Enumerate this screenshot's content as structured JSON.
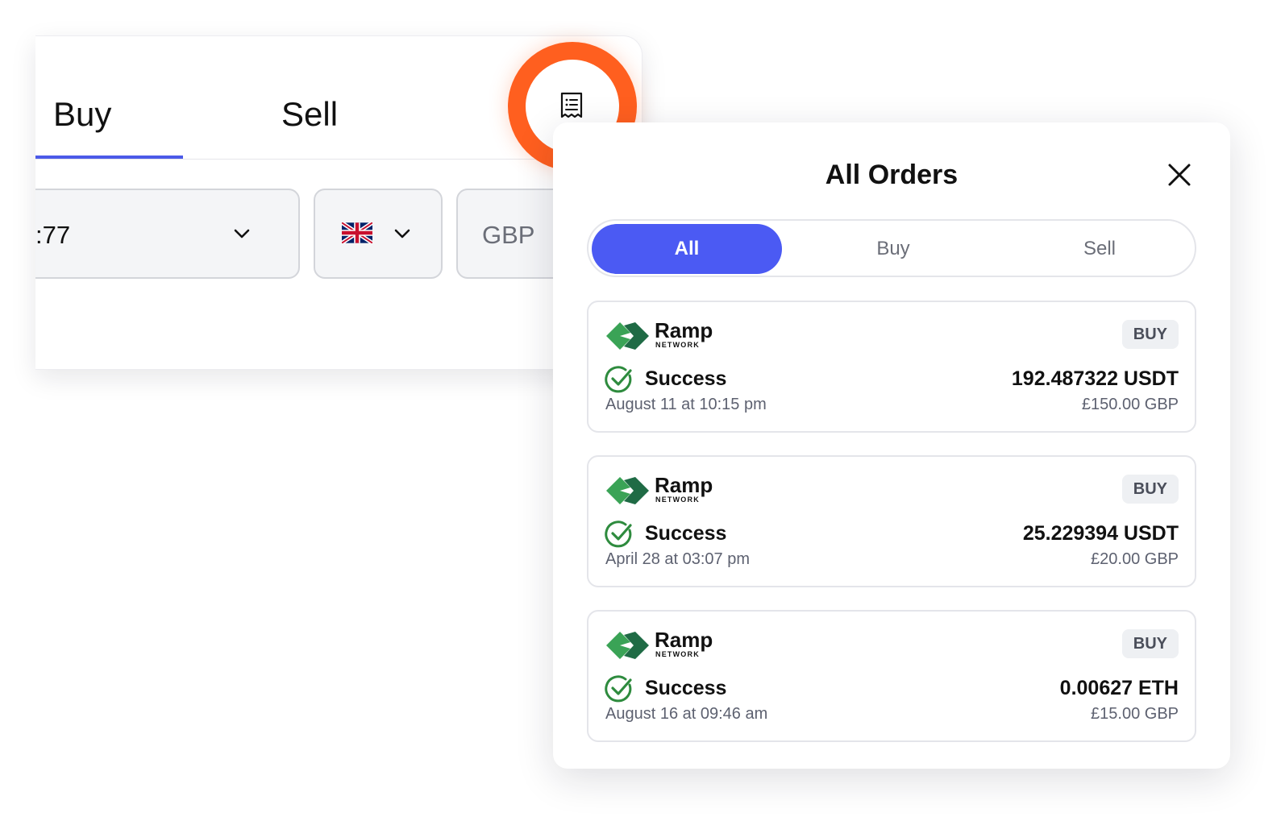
{
  "widget": {
    "tabs": {
      "buy_label": "Buy",
      "sell_label": "Sell",
      "active": "Buy"
    },
    "address_field": {
      "value_fragment": ":77"
    },
    "country_field": {
      "flag_icon": "uk-flag-icon"
    },
    "currency_field": {
      "value": "GBP"
    },
    "orders_button_icon": "receipt-icon",
    "highlight_color": "#ff5f1f",
    "accent_color": "#4b5ae8"
  },
  "orders_panel": {
    "title": "All Orders",
    "close_icon": "close-icon",
    "filters": {
      "all_label": "All",
      "buy_label": "Buy",
      "sell_label": "Sell",
      "selected": "All"
    },
    "orders": [
      {
        "provider": "Ramp",
        "provider_sub": "NETWORK",
        "type": "BUY",
        "status": "Success",
        "date": "August 11 at 10:15 pm",
        "crypto_amount": "192.487322 USDT",
        "fiat_amount": "£150.00 GBP"
      },
      {
        "provider": "Ramp",
        "provider_sub": "NETWORK",
        "type": "BUY",
        "status": "Success",
        "date": "April 28 at 03:07 pm",
        "crypto_amount": "25.229394 USDT",
        "fiat_amount": "£20.00 GBP"
      },
      {
        "provider": "Ramp",
        "provider_sub": "NETWORK",
        "type": "BUY",
        "status": "Success",
        "date": "August 16 at 09:46 am",
        "crypto_amount": "0.00627 ETH",
        "fiat_amount": "£15.00 GBP"
      }
    ],
    "status_color": "#2e8b3e",
    "selected_filter_color": "#4b5af3"
  }
}
